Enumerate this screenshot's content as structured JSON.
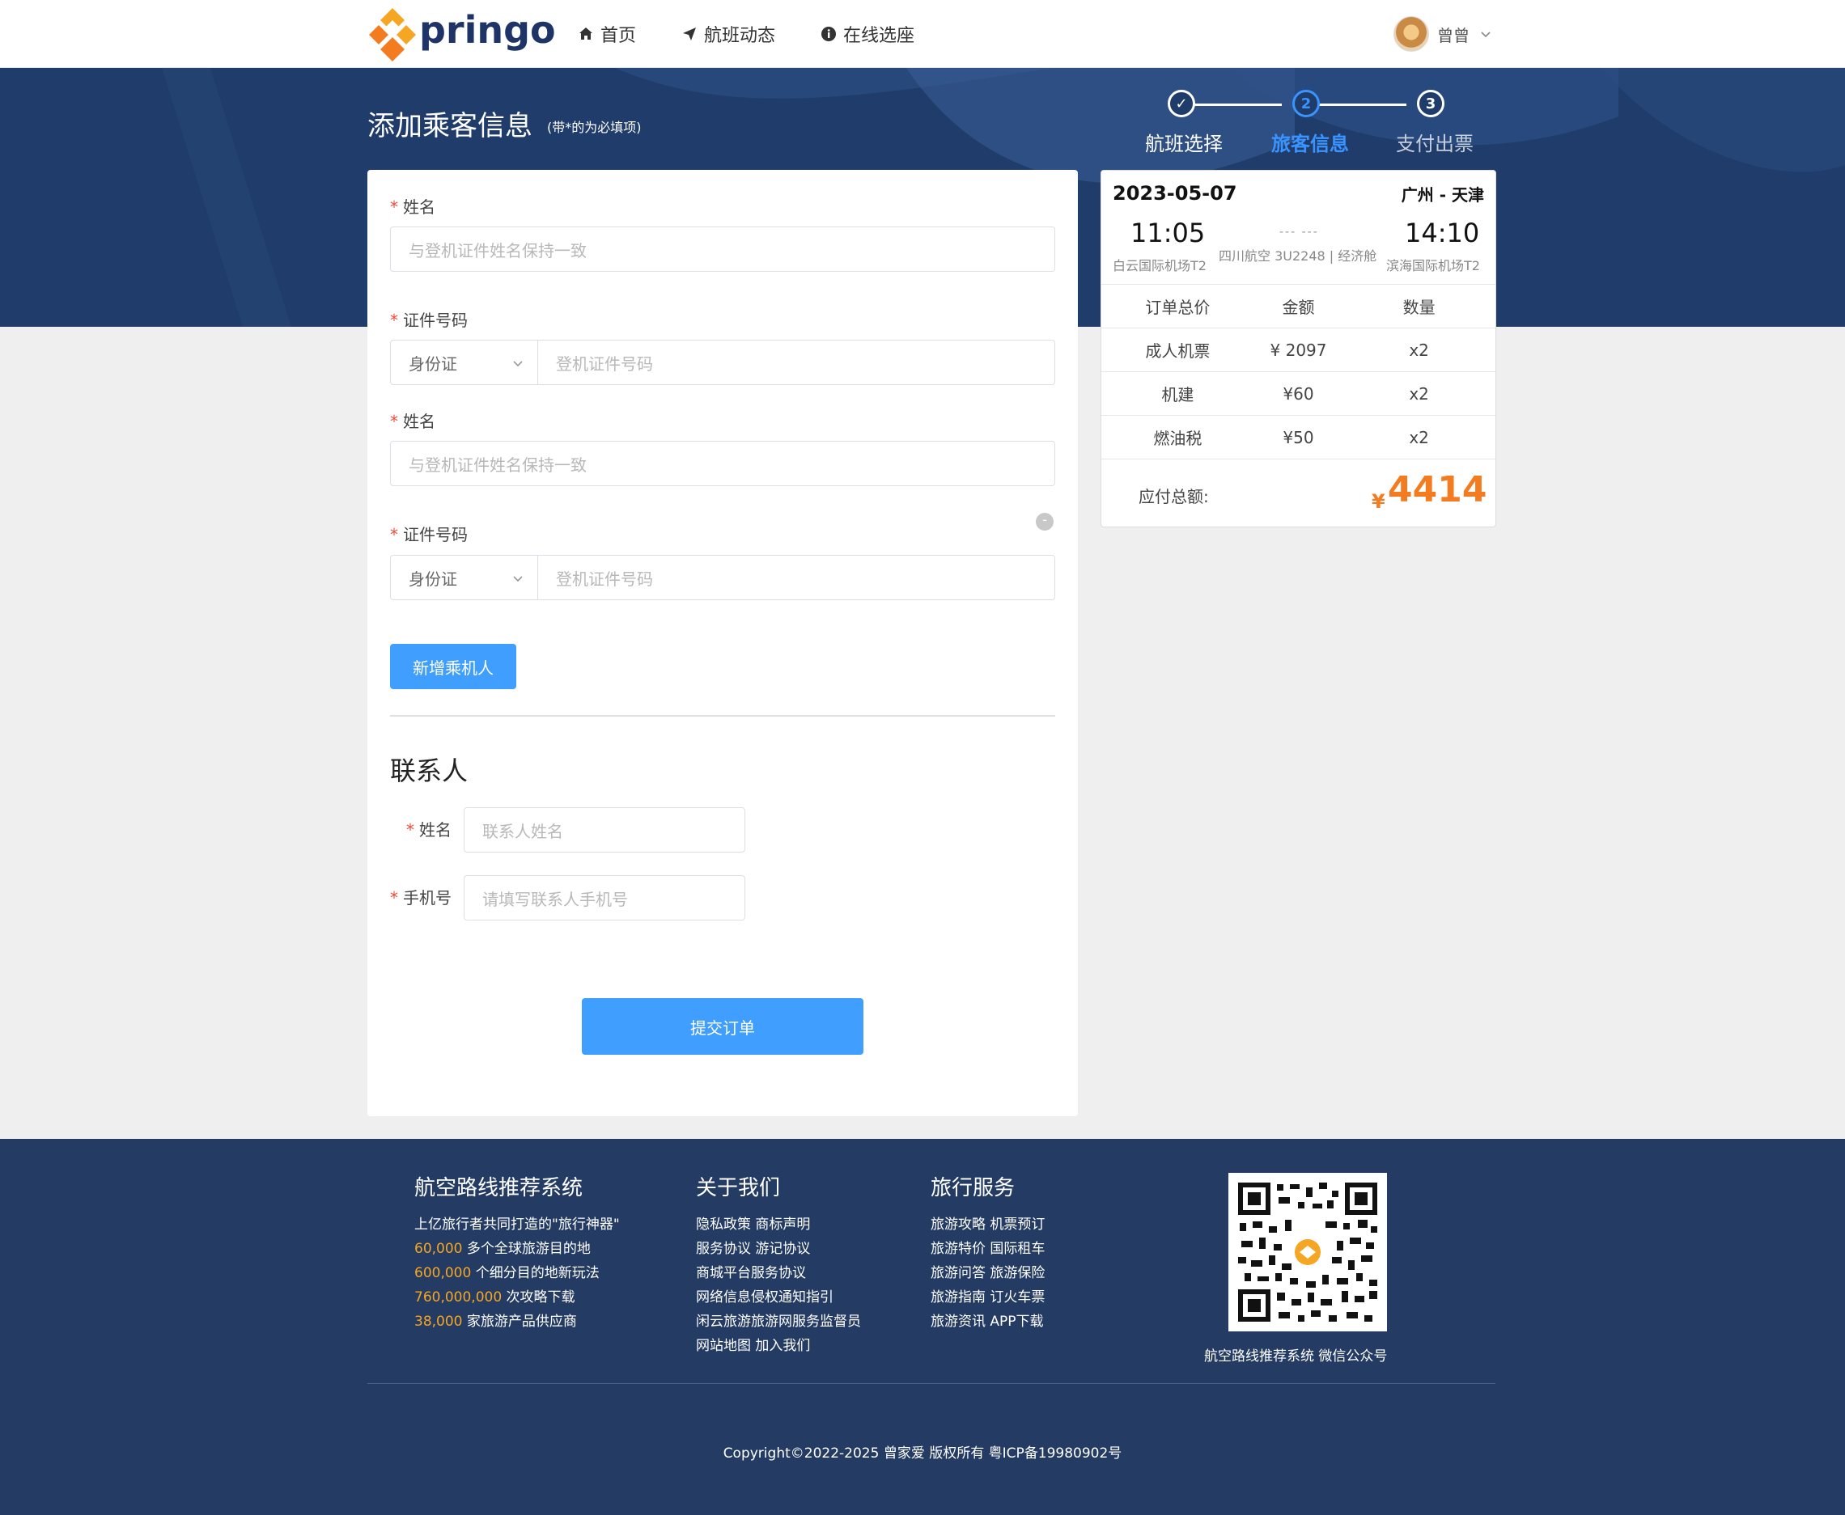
{
  "header": {
    "logo_text": "pringo",
    "nav": [
      {
        "label": "首页",
        "icon": "home-icon"
      },
      {
        "label": "航班动态",
        "icon": "paper-plane-icon"
      },
      {
        "label": "在线选座",
        "icon": "info-circle-icon"
      }
    ],
    "user_name": "曾曾"
  },
  "page": {
    "title": "添加乘客信息",
    "subtitle": "(带*的为必填项)"
  },
  "steps": [
    {
      "num": "✓",
      "label": "航班选择",
      "state": "done"
    },
    {
      "num": "2",
      "label": "旅客信息",
      "state": "active"
    },
    {
      "num": "3",
      "label": "支付出票",
      "state": "todo"
    }
  ],
  "passengers": [
    {
      "name_label": "姓名",
      "name_placeholder": "与登机证件姓名保持一致",
      "id_label": "证件号码",
      "id_type": "身份证",
      "id_placeholder": "登机证件号码"
    },
    {
      "name_label": "姓名",
      "name_placeholder": "与登机证件姓名保持一致",
      "id_label": "证件号码",
      "id_type": "身份证",
      "id_placeholder": "登机证件号码"
    }
  ],
  "remove_label": "-",
  "add_passenger_label": "新增乘机人",
  "contact": {
    "title": "联系人",
    "name_label": "姓名",
    "name_placeholder": "联系人姓名",
    "phone_label": "手机号",
    "phone_placeholder": "请填写联系人手机号"
  },
  "required_mark": "*",
  "submit_label": "提交订单",
  "order": {
    "date": "2023-05-07",
    "route": "广州 - 天津",
    "dep_time": "11:05",
    "arr_time": "14:10",
    "dep_airport": "白云国际机场T2",
    "arr_airport": "滨海国际机场T2",
    "dash": "--- ---",
    "flight_info": "四川航空 3U2248 | 经济舱",
    "table_header": [
      "订单总价",
      "金额",
      "数量"
    ],
    "rows": [
      [
        "成人机票",
        "¥ 2097",
        "x2"
      ],
      [
        "机建",
        "¥60",
        "x2"
      ],
      [
        "燃油税",
        "¥50",
        "x2"
      ]
    ],
    "total_label": "应付总额:",
    "currency": "¥",
    "total": "4414"
  },
  "footer": {
    "col1": {
      "title": "航空路线推荐系统",
      "intro": "上亿旅行者共同打造的\"旅行神器\"",
      "stats": [
        {
          "num": "60,000",
          "text": " 多个全球旅游目的地"
        },
        {
          "num": "600,000",
          "text": " 个细分目的地新玩法"
        },
        {
          "num": "760,000,000",
          "text": " 次攻略下载"
        },
        {
          "num": "38,000",
          "text": " 家旅游产品供应商"
        }
      ]
    },
    "col2": {
      "title": "关于我们",
      "links": [
        "隐私政策 商标声明",
        "服务协议 游记协议",
        "商城平台服务协议",
        "网络信息侵权通知指引",
        "闲云旅游旅游网服务监督员",
        "网站地图 加入我们"
      ]
    },
    "col3": {
      "title": "旅行服务",
      "links": [
        "旅游攻略 机票预订",
        "旅游特价 国际租车",
        "旅游问答 旅游保险",
        "旅游指南 订火车票",
        "旅游资讯 APP下载"
      ]
    },
    "qr_caption": "航空路线推荐系统 微信公众号",
    "copyright": "Copyright©2022-2025 曾家爱 版权所有 粤ICP备19980902号"
  },
  "colors": {
    "primary": "#409eff",
    "navy": "#1f3c6b",
    "accent_orange": "#f47c20",
    "required": "#f04b3a"
  }
}
